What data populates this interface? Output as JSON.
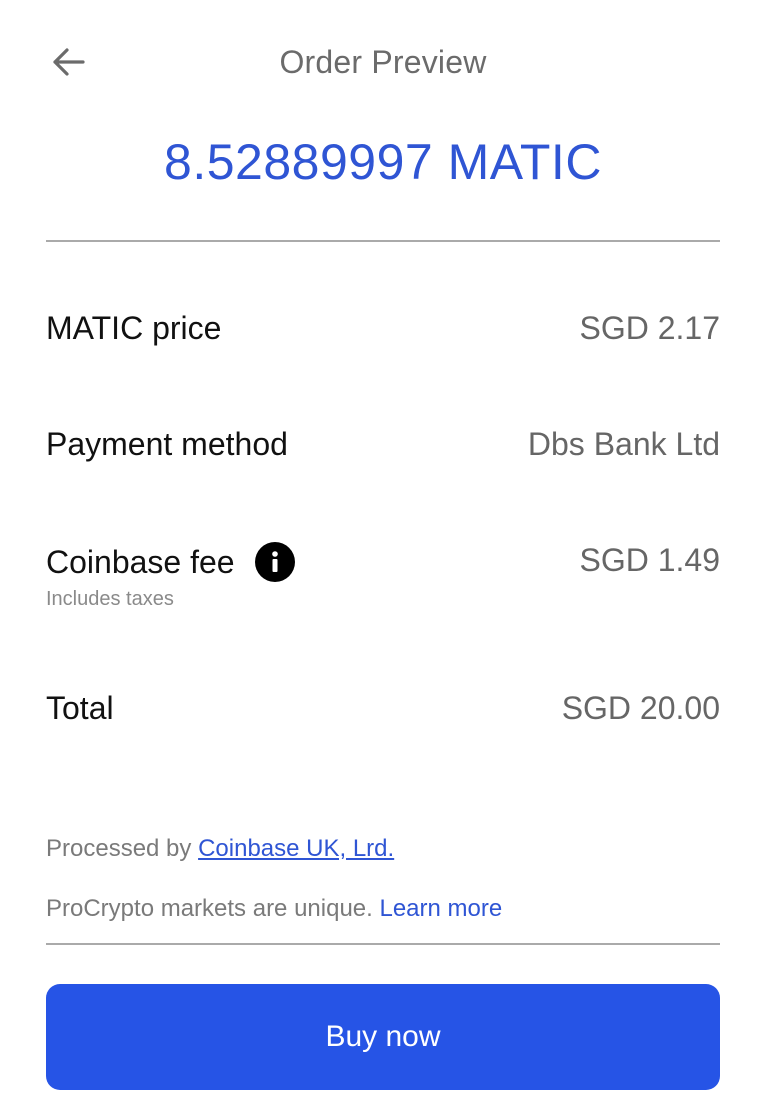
{
  "header": {
    "back_icon": "arrow-left-icon",
    "title": "Order Preview"
  },
  "order": {
    "amount": "8.52889997 MATIC"
  },
  "details": {
    "price": {
      "label": "MATIC price",
      "value": "SGD 2.17"
    },
    "payment": {
      "label": "Payment method",
      "value": "Dbs Bank Ltd"
    },
    "fee": {
      "label": "Coinbase fee",
      "info_icon": "info-icon",
      "sub_label": "Includes taxes",
      "value": "SGD 1.49"
    },
    "total": {
      "label": "Total",
      "value": "SGD 20.00"
    }
  },
  "footer": {
    "processed_prefix": "Processed by ",
    "processed_link": "Coinbase UK, Lrd.",
    "markets_text": "ProCrypto markets are unique. ",
    "markets_link": "Learn more"
  },
  "actions": {
    "buy_label": "Buy now"
  },
  "colors": {
    "accent": "#2f55d4",
    "button": "#2654e6"
  }
}
